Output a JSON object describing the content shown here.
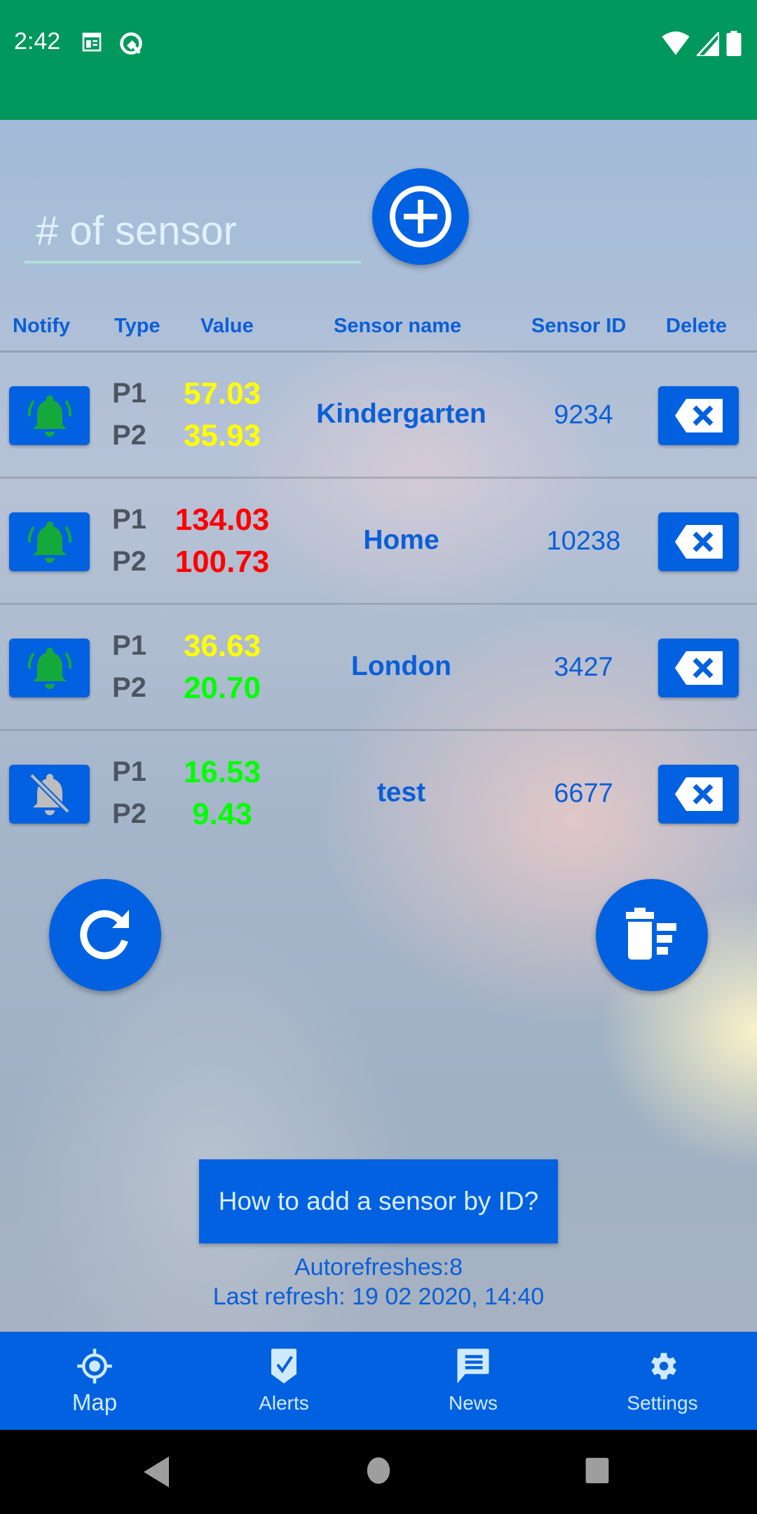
{
  "status_bar": {
    "time": "2:42",
    "left_icons": [
      "news-notification-icon",
      "android-q-icon"
    ],
    "right_icons": [
      "wifi-icon",
      "cellular-signal-icon",
      "battery-icon"
    ],
    "background_color": "#00985c"
  },
  "input": {
    "placeholder": "# of sensor",
    "value": ""
  },
  "add_button": {
    "icon": "add-circle-icon"
  },
  "table": {
    "headers": {
      "notify": "Notify",
      "type": "Type",
      "value": "Value",
      "sensor_name": "Sensor name",
      "sensor_id": "Sensor ID",
      "delete": "Delete"
    },
    "rows": [
      {
        "notify": true,
        "p1_label": "P1",
        "p1_value": "57.03",
        "p1_color": "#ffff00",
        "p2_label": "P2",
        "p2_value": "35.93",
        "p2_color": "#ffff00",
        "name": "Kindergarten",
        "id": "9234"
      },
      {
        "notify": true,
        "p1_label": "P1",
        "p1_value": "134.03",
        "p1_color": "#ff0000",
        "p2_label": "P2",
        "p2_value": "100.73",
        "p2_color": "#ff0000",
        "name": "Home",
        "id": "10238"
      },
      {
        "notify": true,
        "p1_label": "P1",
        "p1_value": "36.63",
        "p1_color": "#ffff00",
        "p2_label": "P2",
        "p2_value": "20.70",
        "p2_color": "#00ff00",
        "name": "London",
        "id": "3427"
      },
      {
        "notify": false,
        "p1_label": "P1",
        "p1_value": "16.53",
        "p1_color": "#00ff00",
        "p2_label": "P2",
        "p2_value": "9.43",
        "p2_color": "#00ff00",
        "name": "test",
        "id": "6677"
      }
    ]
  },
  "actions": {
    "refresh_icon": "refresh-icon",
    "clear_all_icon": "delete-sweep-icon"
  },
  "help_button": "How to add a sensor by ID?",
  "autorefreshes": "Autorefreshes:8",
  "last_refresh": "Last refresh: 19 02 2020, 14:40",
  "bottom_nav": {
    "items": [
      {
        "label": "Map",
        "icon": "gps-target-icon",
        "active": true
      },
      {
        "label": "Alerts",
        "icon": "alert-check-icon",
        "active": false
      },
      {
        "label": "News",
        "icon": "chat-message-icon",
        "active": false
      },
      {
        "label": "Settings",
        "icon": "gear-icon",
        "active": false
      }
    ]
  },
  "colors": {
    "accent": "#0261e0",
    "text_blue": "#0a5fd8",
    "bell_on": "#15a93c",
    "bell_off": "#bdbdbd"
  }
}
